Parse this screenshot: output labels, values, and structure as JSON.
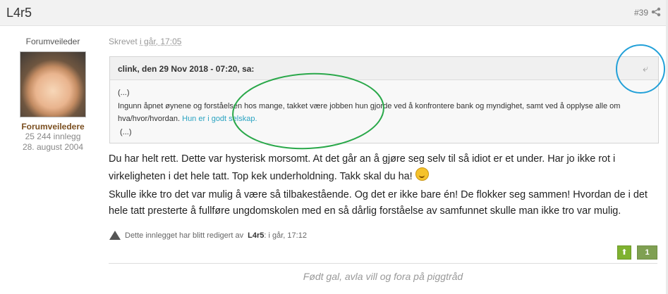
{
  "post": {
    "username": "L4r5",
    "post_number": "#39",
    "share_icon": "share-icon",
    "written_prefix": "Skrevet",
    "written_date": "i går, 17:05"
  },
  "user": {
    "role": "Forumveileder",
    "rank": "Forumveiledere",
    "posts": "25 244 innlegg",
    "joined": "28. august 2004"
  },
  "quote": {
    "author": "clink, den 29 Nov 2018 - 07:20, sa:",
    "ellipsis_top": "(...)",
    "text": "Ingunn åpnet øynene og forståelsen hos mange, takket være jobben hun gjorde ved å konfrontere bank og myndighet, samt ved å opplyse alle om hva/hvor/hvordan.",
    "link": "Hun er i godt selskap.",
    "ellipsis_bottom": "(...)",
    "icon": "return-arrow-icon"
  },
  "body": {
    "p1": "Du har helt rett. Dette var hysterisk morsomt. At det går an å gjøre seg selv til så idiot er et under. Har jo ikke rot i virkeligheten i det hele tatt. Top kek underholdning. Takk skal du ha!",
    "p2": "Skulle ikke tro det var mulig å være så tilbakestående. Og det er ikke bare én! De flokker seg sammen! Hvordan de i det hele tatt presterte å fullføre ungdomskolen med en så dårlig forståelse av samfunnet skulle man ikke tro var mulig."
  },
  "edited": {
    "prefix": "Dette innlegget har blitt redigert av",
    "user": "L4r5",
    "suffix": ": i går, 17:12"
  },
  "reputation": {
    "up_symbol": "⬆",
    "count": "1"
  },
  "signature": "Født gal, avla vill og fora på piggtråd",
  "colors": {
    "green_annotation": "#2aa84a",
    "blue_annotation": "#22a0d8",
    "rep_green": "#7fb230",
    "link": "#2aa3c1"
  }
}
